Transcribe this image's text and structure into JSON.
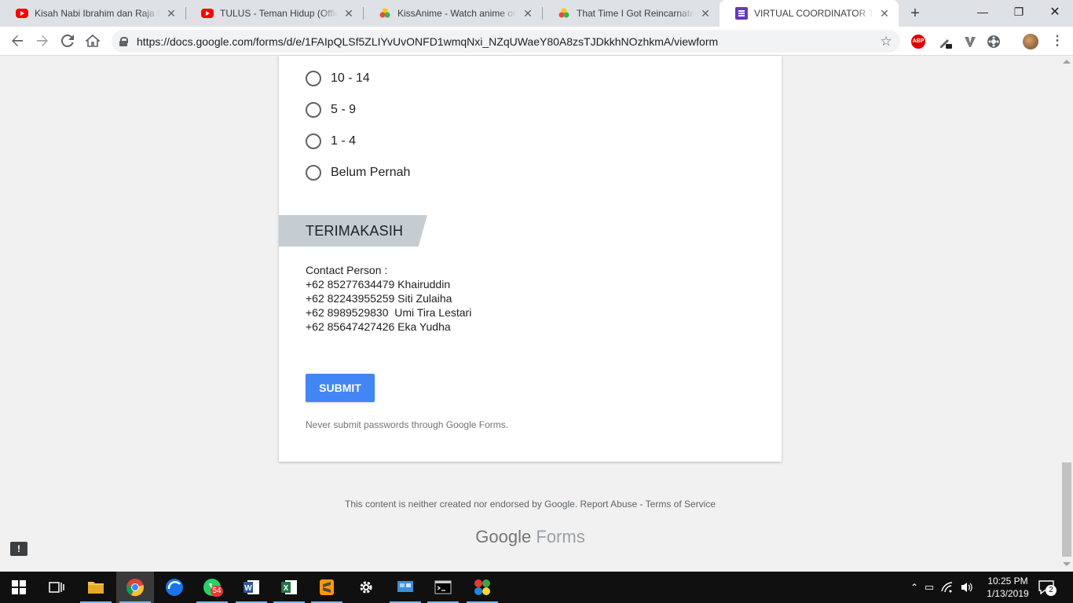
{
  "browser": {
    "tabs": [
      {
        "title": "Kisah Nabi Ibrahim dan Raja Namrud",
        "favicon": "youtube-icon",
        "active": false
      },
      {
        "title": "TULUS - Teman Hidup (Official Music Video)",
        "favicon": "youtube-icon",
        "active": false
      },
      {
        "title": "KissAnime - Watch anime online",
        "favicon": "kissanime-icon",
        "active": false
      },
      {
        "title": "That Time I Got Reincarnated as a Slime",
        "favicon": "kissanime-icon",
        "active": false
      },
      {
        "title": "VIRTUAL COORDINATOR TRAINING",
        "favicon": "google-forms-icon",
        "active": true
      }
    ],
    "url": "https://docs.google.com/forms/d/e/1FAIpQLSf5ZLIYvUvONFD1wmqNxi_NZqUWaeY80A8zsTJDkkhNOzhkmA/viewform",
    "extensions": [
      "adblock-plus-icon",
      "extension-eyedropper-icon",
      "extension-v-icon",
      "extension-film-icon",
      "profile-avatar-icon"
    ]
  },
  "form": {
    "options": [
      "10 - 14",
      "5 - 9",
      "1 - 4",
      "Belum Pernah"
    ],
    "section_title": "TERIMAKASIH",
    "contact_text": "Contact Person :\n+62 85277634479 Khairuddin\n+62 82243955259 Siti Zulaiha\n+62 8989529830  Umi Tira Lestari\n+62 85647427426 Eka Yudha",
    "submit_label": "SUBMIT",
    "password_note": "Never submit passwords through Google Forms."
  },
  "footer": {
    "disclaimer": "This content is neither created nor endorsed by Google. Report Abuse - Terms of Service",
    "logo_google": "Google",
    "logo_forms": "Forms"
  },
  "taskbar": {
    "apps": [
      "task-view-icon",
      "file-explorer-icon",
      "chrome-icon",
      "browser-icon",
      "whatsapp-icon",
      "word-icon",
      "excel-icon",
      "sublime-icon",
      "settings-icon",
      "control-panel-icon",
      "terminal-icon",
      "app-icon"
    ],
    "whatsapp_badge": "54",
    "time": "10:25 PM",
    "date": "1/13/2019",
    "notification_count": "2"
  },
  "colors": {
    "submit": "#4285f4",
    "section_banner": "#c5cdd3",
    "forms_purple": "#673ab7"
  }
}
